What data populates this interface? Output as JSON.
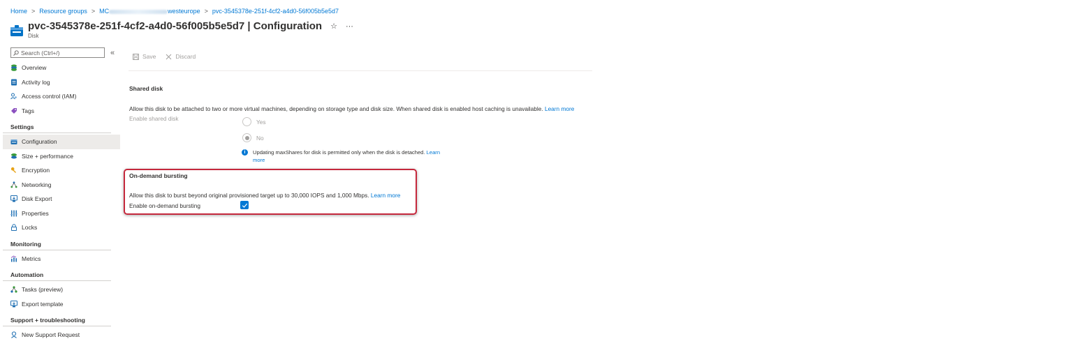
{
  "breadcrumb": {
    "home": "Home",
    "resource_groups": "Resource groups",
    "rg_prefix": "MC",
    "rg_suffix": "westeurope",
    "disk": "pvc-3545378e-251f-4cf2-a4d0-56f005b5e5d7",
    "separator": ">"
  },
  "header": {
    "resource_name": "pvc-3545378e-251f-4cf2-a4d0-56f005b5e5d7",
    "separator": "|",
    "page": "Configuration",
    "subtitle": "Disk",
    "favorite_icon": "star-icon",
    "more_icon": "ellipsis-icon"
  },
  "sidebar": {
    "search_placeholder": "Search (Ctrl+/)",
    "collapse_glyph": "«",
    "top_items": [
      {
        "label": "Overview",
        "icon": "overview-icon"
      },
      {
        "label": "Activity log",
        "icon": "activity-log-icon"
      },
      {
        "label": "Access control (IAM)",
        "icon": "iam-icon"
      },
      {
        "label": "Tags",
        "icon": "tag-icon"
      }
    ],
    "sections": {
      "settings": "Settings",
      "monitoring": "Monitoring",
      "automation": "Automation",
      "support": "Support + troubleshooting"
    },
    "settings_items": [
      {
        "label": "Configuration",
        "icon": "configuration-icon",
        "active": true
      },
      {
        "label": "Size + performance",
        "icon": "size-performance-icon"
      },
      {
        "label": "Encryption",
        "icon": "key-icon"
      },
      {
        "label": "Networking",
        "icon": "networking-icon"
      },
      {
        "label": "Disk Export",
        "icon": "disk-export-icon"
      },
      {
        "label": "Properties",
        "icon": "properties-icon"
      },
      {
        "label": "Locks",
        "icon": "lock-icon"
      }
    ],
    "monitoring_items": [
      {
        "label": "Metrics",
        "icon": "metrics-icon"
      }
    ],
    "automation_items": [
      {
        "label": "Tasks (preview)",
        "icon": "tasks-icon"
      },
      {
        "label": "Export template",
        "icon": "export-template-icon"
      }
    ],
    "support_items": [
      {
        "label": "New Support Request",
        "icon": "support-icon"
      }
    ]
  },
  "toolbar": {
    "save": "Save",
    "discard": "Discard"
  },
  "shared_disk": {
    "heading": "Shared disk",
    "description": "Allow this disk to be attached to two or more virtual machines, depending on storage type and disk size. When shared disk is enabled host caching is unavailable.",
    "learn_more": "Learn more",
    "label": "Enable shared disk",
    "option_yes": "Yes",
    "option_no": "No",
    "selected": "No",
    "info": "Updating maxShares for disk is permitted only when the disk is detached.",
    "info_learn": "Learn",
    "info_more": "more"
  },
  "bursting": {
    "heading": "On-demand bursting",
    "description": "Allow this disk to burst beyond original provisioned target up to 30,000 IOPS and 1,000 Mbps.",
    "learn_more": "Learn more",
    "label": "Enable on-demand bursting",
    "checked": true
  },
  "colors": {
    "accent": "#0078d4",
    "highlight_border": "#c5283c"
  }
}
